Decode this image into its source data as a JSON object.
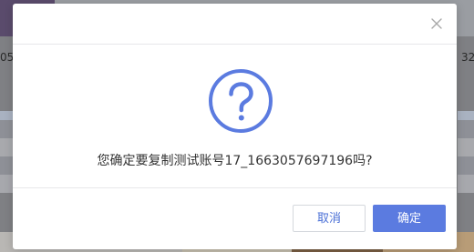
{
  "background": {
    "left_fragment": "05",
    "right_fragment": "32"
  },
  "dialog": {
    "close_icon": "close-icon",
    "question_icon": "question-circle-icon",
    "accent_color": "#5b7be0",
    "message": "您确定要复制测试账号17_1663057697196吗?",
    "cancel_label": "取消",
    "confirm_label": "确定"
  }
}
